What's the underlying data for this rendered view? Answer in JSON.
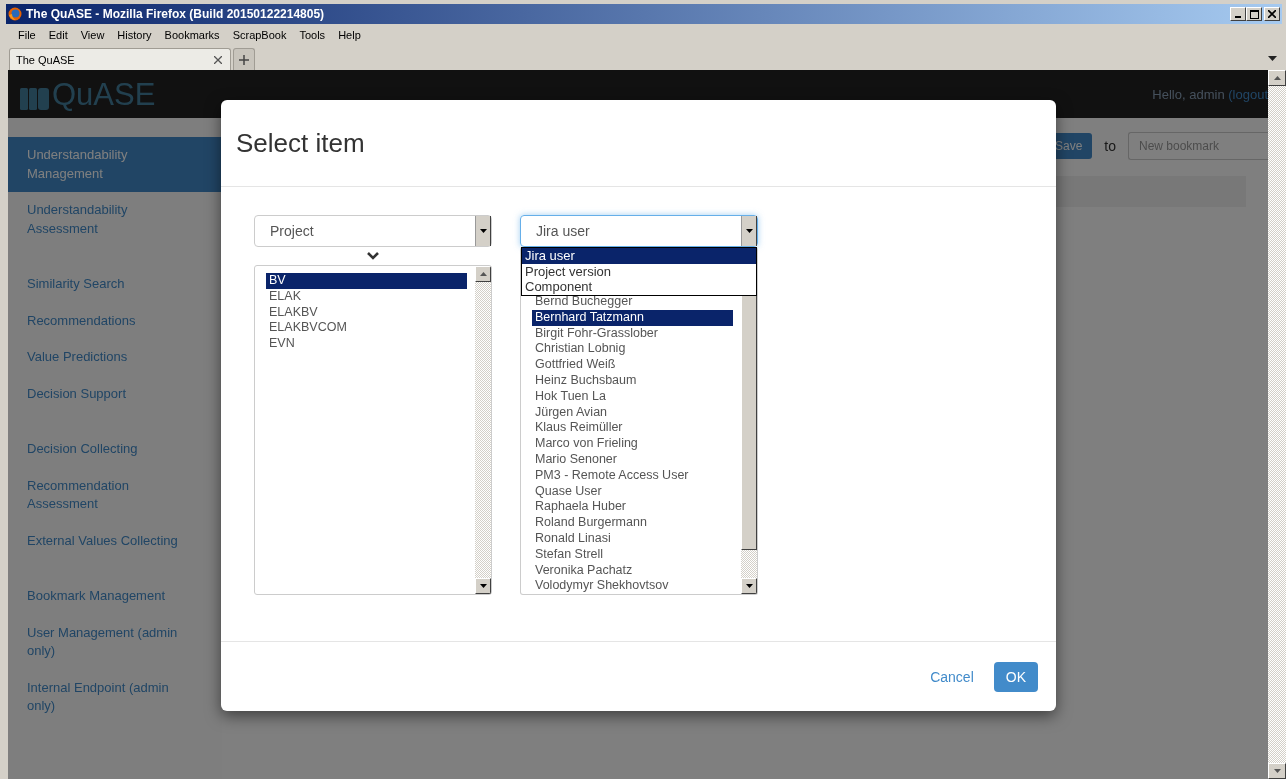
{
  "window": {
    "title": "The QuASE - Mozilla Firefox (Build 20150122214805)"
  },
  "menu": [
    "File",
    "Edit",
    "View",
    "History",
    "Bookmarks",
    "ScrapBook",
    "Tools",
    "Help"
  ],
  "tabs": [
    {
      "label": "The QuASE",
      "selected": true
    }
  ],
  "header": {
    "logo": "QuASE",
    "greeting": "Hello, admin",
    "logout": "(logout"
  },
  "sidebar": {
    "groups": [
      {
        "items": [
          {
            "label": "Understandability Management",
            "selected": true
          },
          {
            "label": "Understandability Assessment",
            "selected": false
          }
        ]
      },
      {
        "items": [
          {
            "label": "Similarity Search",
            "selected": false
          },
          {
            "label": "Recommendations",
            "selected": false
          },
          {
            "label": "Value Predictions",
            "selected": false
          },
          {
            "label": "Decision Support",
            "selected": false
          }
        ]
      },
      {
        "items": [
          {
            "label": "Decision Collecting",
            "selected": false
          },
          {
            "label": "Recommendation Assessment",
            "selected": false
          },
          {
            "label": "External Values Collecting",
            "selected": false
          }
        ]
      },
      {
        "items": [
          {
            "label": "Bookmark Management",
            "selected": false
          },
          {
            "label": "User Management (admin only)",
            "selected": false
          },
          {
            "label": "Internal Endpoint (admin only)",
            "selected": false
          }
        ]
      }
    ]
  },
  "toolbar": {
    "save": "Save",
    "to": "to",
    "bookmark_placeholder": "New bookmark"
  },
  "modal": {
    "title": "Select item",
    "left": {
      "select": {
        "value": "Project",
        "expanded": false
      },
      "items": [
        {
          "label": "BV",
          "selected": true
        },
        {
          "label": "ELAK",
          "selected": false
        },
        {
          "label": "ELAKBV",
          "selected": false
        },
        {
          "label": "ELAKBVCOM",
          "selected": false
        },
        {
          "label": "EVN",
          "selected": false
        }
      ]
    },
    "right": {
      "select": {
        "value": "Jira user",
        "expanded": true,
        "options": [
          {
            "label": "Jira user",
            "selected": true
          },
          {
            "label": "Project version",
            "selected": false
          },
          {
            "label": "Component",
            "selected": false
          }
        ]
      },
      "items": [
        {
          "label": "Bernd Buchegger",
          "selected": false
        },
        {
          "label": "Bernhard Tatzmann",
          "selected": true
        },
        {
          "label": "Birgit Fohr-Grasslober",
          "selected": false
        },
        {
          "label": "Christian Lobnig",
          "selected": false
        },
        {
          "label": "Gottfried Weiß",
          "selected": false
        },
        {
          "label": "Heinz Buchsbaum",
          "selected": false
        },
        {
          "label": "Hok Tuen La",
          "selected": false
        },
        {
          "label": "Jürgen Avian",
          "selected": false
        },
        {
          "label": "Klaus Reimüller",
          "selected": false
        },
        {
          "label": "Marco von Frieling",
          "selected": false
        },
        {
          "label": "Mario Senoner",
          "selected": false
        },
        {
          "label": "PM3 - Remote Access User",
          "selected": false
        },
        {
          "label": "Quase User",
          "selected": false
        },
        {
          "label": "Raphaela Huber",
          "selected": false
        },
        {
          "label": "Roland Burgermann",
          "selected": false
        },
        {
          "label": "Ronald Linasi",
          "selected": false
        },
        {
          "label": "Stefan Strell",
          "selected": false
        },
        {
          "label": "Veronika Pachatz",
          "selected": false
        },
        {
          "label": "Volodymyr Shekhovtsov",
          "selected": false
        }
      ]
    },
    "cancel": "Cancel",
    "ok": "OK"
  }
}
